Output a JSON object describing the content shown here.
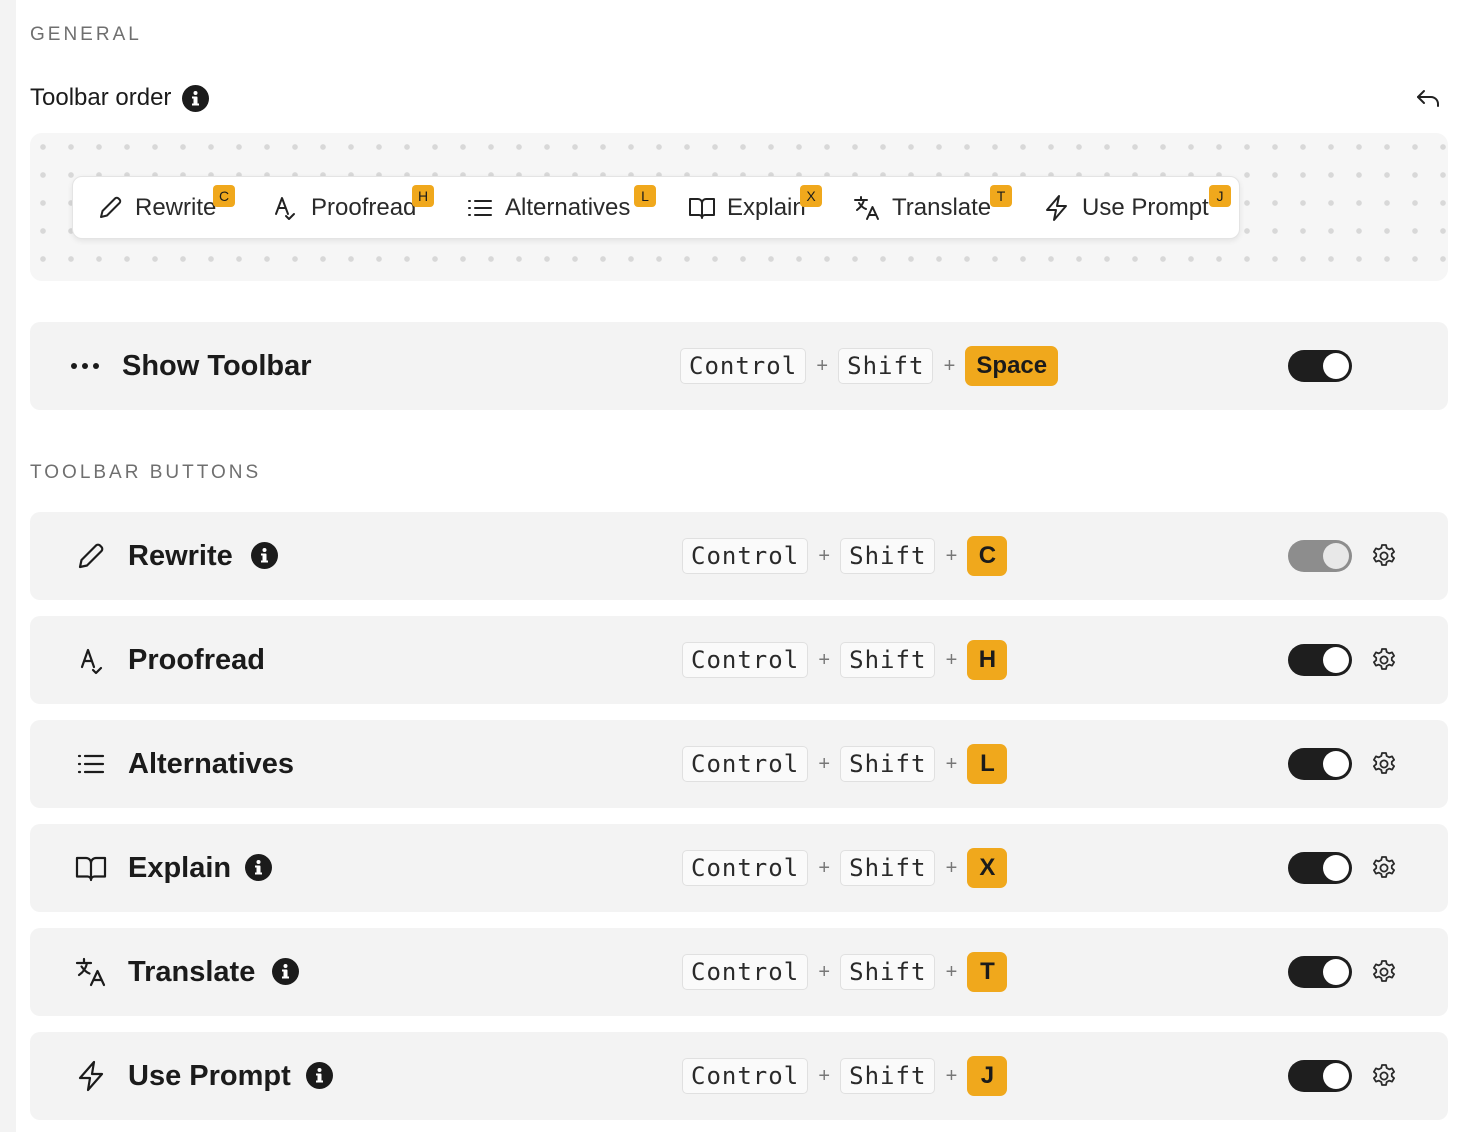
{
  "general": {
    "heading": "GENERAL"
  },
  "toolbar_order": {
    "label": "Toolbar order",
    "info_icon": "info-icon",
    "undo_icon": "undo-icon"
  },
  "preview_items": [
    {
      "label": "Rewrite",
      "badge": "C",
      "icon": "pencil-icon"
    },
    {
      "label": "Proofread",
      "badge": "H",
      "icon": "spellcheck-icon"
    },
    {
      "label": "Alternatives",
      "badge": "L",
      "icon": "list-icon"
    },
    {
      "label": "Explain",
      "badge": "X",
      "icon": "book-icon"
    },
    {
      "label": "Translate",
      "badge": "T",
      "icon": "translate-icon"
    },
    {
      "label": "Use Prompt",
      "badge": "J",
      "icon": "lightning-icon"
    }
  ],
  "show_toolbar": {
    "label": "Show Toolbar",
    "icon": "more-dots-icon",
    "keys": [
      "Control",
      "Shift"
    ],
    "accent_key": "Space",
    "plus": "+",
    "enabled": true
  },
  "toolbar_buttons": {
    "heading": "TOOLBAR BUTTONS",
    "rows": [
      {
        "label": "Rewrite",
        "icon": "pencil-icon",
        "keys": [
          "Control",
          "Shift"
        ],
        "accent_key": "C",
        "plus": "+",
        "enabled": false,
        "info": true
      },
      {
        "label": "Proofread",
        "icon": "spellcheck-icon",
        "keys": [
          "Control",
          "Shift"
        ],
        "accent_key": "H",
        "plus": "+",
        "enabled": true,
        "info": false
      },
      {
        "label": "Alternatives",
        "icon": "list-icon",
        "keys": [
          "Control",
          "Shift"
        ],
        "accent_key": "L",
        "plus": "+",
        "enabled": true,
        "info": false
      },
      {
        "label": "Explain",
        "icon": "book-icon",
        "keys": [
          "Control",
          "Shift"
        ],
        "accent_key": "X",
        "plus": "+",
        "enabled": true,
        "info": true
      },
      {
        "label": "Translate",
        "icon": "translate-icon",
        "keys": [
          "Control",
          "Shift"
        ],
        "accent_key": "T",
        "plus": "+",
        "enabled": true,
        "info": true
      },
      {
        "label": "Use Prompt",
        "icon": "lightning-icon",
        "keys": [
          "Control",
          "Shift"
        ],
        "accent_key": "J",
        "plus": "+",
        "enabled": true,
        "info": true
      }
    ]
  },
  "colors": {
    "accent": "#f0a81c",
    "row_bg": "#f3f3f3",
    "toggle_on": "#1e1e1e",
    "toggle_off": "#8d8d8d"
  }
}
